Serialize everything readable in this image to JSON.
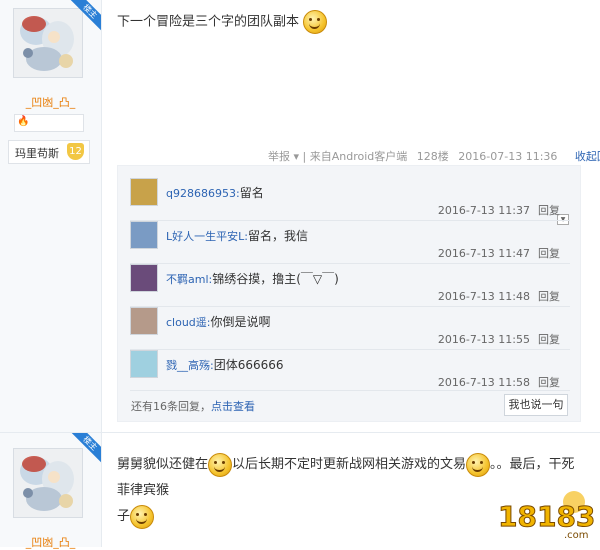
{
  "post1": {
    "user": "_凹凼_凸_",
    "badge_corner": "楼主",
    "badge_name": "玛里苟斯",
    "badge_level": "12",
    "content": "下一个冒险是三个字的团队副本",
    "meta": {
      "report": "举报",
      "source": "来自Android客户端",
      "floor": "128楼",
      "time": "2016-07-13 11:36",
      "collapse": "收起回复"
    }
  },
  "replies": [
    {
      "user": "q928686953",
      "text": "留名",
      "time": "2016-7-13 11:37",
      "reply_label": "回复"
    },
    {
      "user": "L好人一生平安L",
      "text": "留名，我信",
      "time": "2016-7-13 11:47",
      "reply_label": "回复"
    },
    {
      "user": "不羁aml",
      "text": "锦绣谷摸，撸主(￣▽￣)",
      "time": "2016-7-13 11:48",
      "reply_label": "回复"
    },
    {
      "user": "cloud遥",
      "text": "你倒是说啊",
      "time": "2016-7-13 11:55",
      "reply_label": "回复"
    },
    {
      "user": "戮__高殇",
      "text": "团体666666",
      "time": "2016-7-13 11:58",
      "reply_label": "回复"
    }
  ],
  "reply_footer": {
    "more_prefix": "还有16条回复，",
    "more_link": "点击查看",
    "say_button": "我也说一句"
  },
  "post2": {
    "user": "_凹凼_凸_",
    "badge_corner": "楼主",
    "content_part1": "舅舅貌似还健在",
    "content_part2": "以后长期不定时更新战网相关游戏的文易",
    "content_part3": "。。最后，干死菲律宾猴",
    "content_part4": "子"
  },
  "watermark": {
    "text": "18183",
    "sub": ".com"
  },
  "colors": {
    "link": "#2d64b3",
    "username": "#e87a00",
    "badge_blue": "#2a7fd6",
    "reply_bg": "#f3f5f8"
  }
}
